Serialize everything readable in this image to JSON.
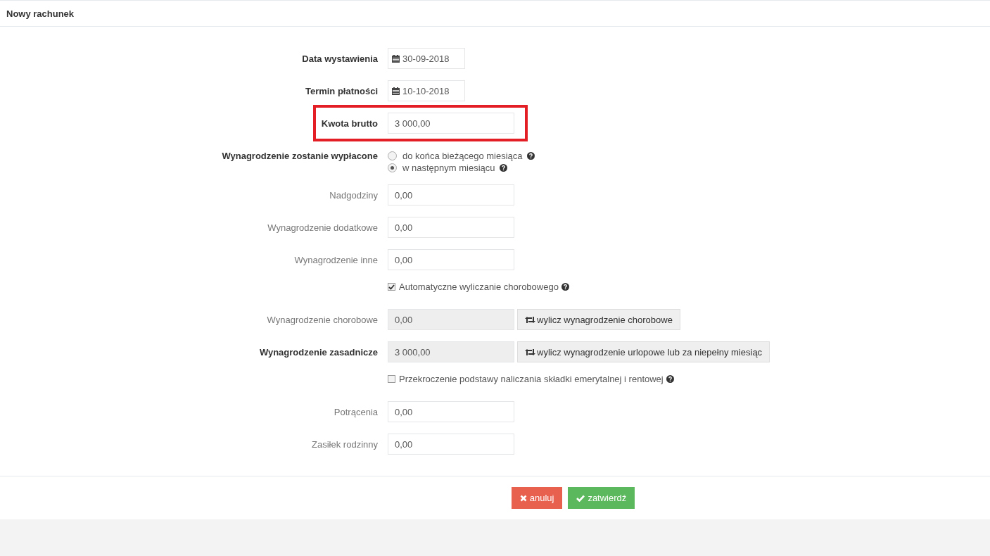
{
  "panel": {
    "title": "Nowy rachunek"
  },
  "rows": [
    {
      "kind": "date",
      "label": "Data wystawienia",
      "bold": true,
      "highlighted": false,
      "value": "30-09-2018"
    },
    {
      "kind": "date",
      "label": "Termin płatności",
      "bold": true,
      "highlighted": false,
      "value": "10-10-2018"
    },
    {
      "kind": "text",
      "label": "Kwota brutto",
      "bold": true,
      "highlighted": true,
      "value": "3 000,00"
    },
    {
      "kind": "radio",
      "label": "Wynagrodzenie zostanie wypłacone",
      "bold": true,
      "highlighted": false,
      "options": [
        {
          "label": "do końca bieżącego miesiąca",
          "selected": false,
          "help": true
        },
        {
          "label": "w następnym miesiącu",
          "selected": true,
          "help": true
        }
      ]
    },
    {
      "kind": "text",
      "label": "Nadgodziny",
      "bold": false,
      "highlighted": false,
      "value": "0,00"
    },
    {
      "kind": "text",
      "label": "Wynagrodzenie dodatkowe",
      "bold": false,
      "highlighted": false,
      "value": "0,00"
    },
    {
      "kind": "text",
      "label": "Wynagrodzenie inne",
      "bold": false,
      "highlighted": false,
      "value": "0,00"
    },
    {
      "kind": "checkbox",
      "label": "Automatyczne wyliczanie chorobowego",
      "checked": true,
      "help": true
    },
    {
      "kind": "computed",
      "label": "Wynagrodzenie chorobowe",
      "bold": false,
      "highlighted": false,
      "value": "0,00",
      "readonly": true,
      "button": "wylicz wynagrodzenie chorobowe"
    },
    {
      "kind": "computed",
      "label": "Wynagrodzenie zasadnicze",
      "bold": true,
      "highlighted": false,
      "value": "3 000,00",
      "readonly": true,
      "button": "wylicz wynagrodzenie urlopowe lub za niepełny miesiąc"
    },
    {
      "kind": "checkbox",
      "label": "Przekroczenie podstawy naliczania składki emerytalnej i rentowej",
      "checked": false,
      "help": true
    },
    {
      "kind": "text",
      "label": "Potrącenia",
      "bold": false,
      "highlighted": false,
      "value": "0,00"
    },
    {
      "kind": "text",
      "label": "Zasiłek rodzinny",
      "bold": false,
      "highlighted": false,
      "value": "0,00"
    }
  ],
  "buttons": [
    {
      "kind": "cancel",
      "label": "anuluj"
    },
    {
      "kind": "confirm",
      "label": "zatwierdź"
    }
  ]
}
